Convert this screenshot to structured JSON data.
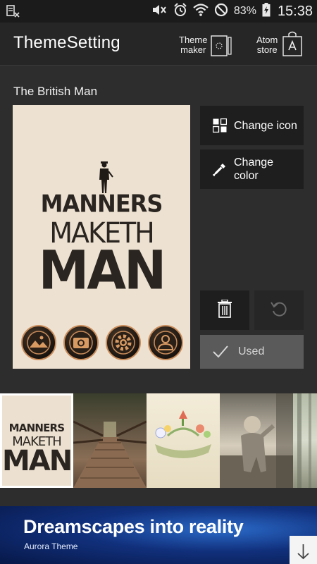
{
  "status_bar": {
    "battery_percent": "83%",
    "time": "15:38"
  },
  "app_bar": {
    "title": "ThemeSetting",
    "theme_maker_label": [
      "Theme",
      "maker"
    ],
    "atom_store_label": [
      "Atom",
      "store"
    ]
  },
  "theme": {
    "name": "The British Man",
    "preview_lines": [
      "MANNERS",
      "MAKETH",
      "MAN"
    ]
  },
  "actions": {
    "change_icon": "Change icon",
    "change_color": [
      "Change",
      "color"
    ],
    "used": "Used"
  },
  "thumbnails": [
    {
      "lines": [
        "MANNERS",
        "MAKETH",
        "MAN"
      ],
      "selected": true
    },
    {
      "subject": "wooden bridge"
    },
    {
      "subject": "spring"
    },
    {
      "subject": "child"
    },
    {
      "subject": "forest"
    }
  ],
  "ad": {
    "title": "Dreamscapes into reality",
    "subtitle": "Aurora Theme"
  },
  "colors": {
    "background": "#2d2d2d",
    "button": "#1e1e1e",
    "used_button": "#5a5a5a",
    "accent_copper": "#c98c5a",
    "preview_bg": "#ede1d1"
  }
}
